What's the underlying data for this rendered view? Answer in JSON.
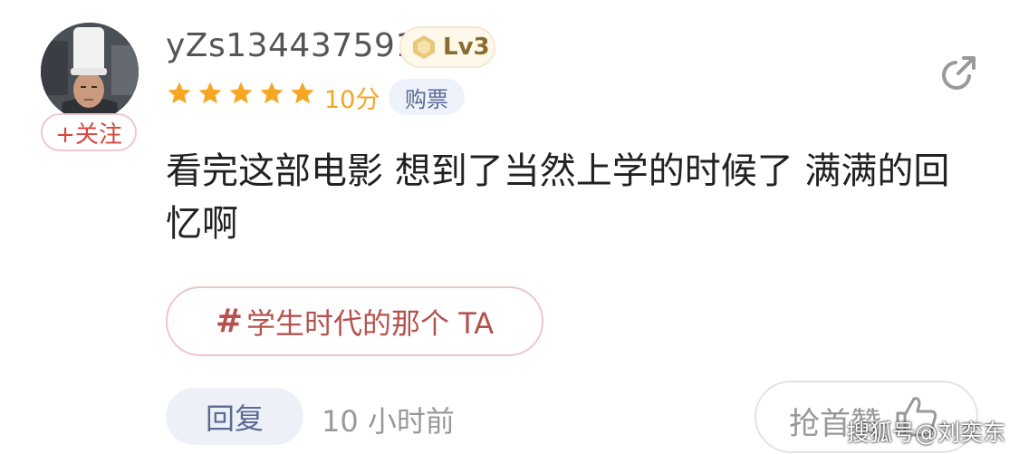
{
  "user": {
    "username": "yZs134437591",
    "level": "Lv3",
    "follow_label": "+关注"
  },
  "rating": {
    "stars": 5,
    "max_stars": 5,
    "score": "10分",
    "tag": "购票"
  },
  "comment": {
    "text": "看完这部电影 想到了当然上学的时候了 满满的回忆啊"
  },
  "topic": {
    "hash": "#",
    "label": "学生时代的那个 TA"
  },
  "footer": {
    "reply_label": "回复",
    "time": "10 小时前",
    "like_label": "抢首赞"
  },
  "watermark": "搜狐号@刘奕东",
  "icons": [
    "share-icon",
    "thumb-up-icon",
    "star-icon",
    "level-hexagon-icon"
  ],
  "colors": {
    "star": "#f5a623",
    "follow": "#d4463f",
    "topic": "#b5524e",
    "reply_bg": "#edf0f7",
    "reply_text": "#5a6c94"
  }
}
